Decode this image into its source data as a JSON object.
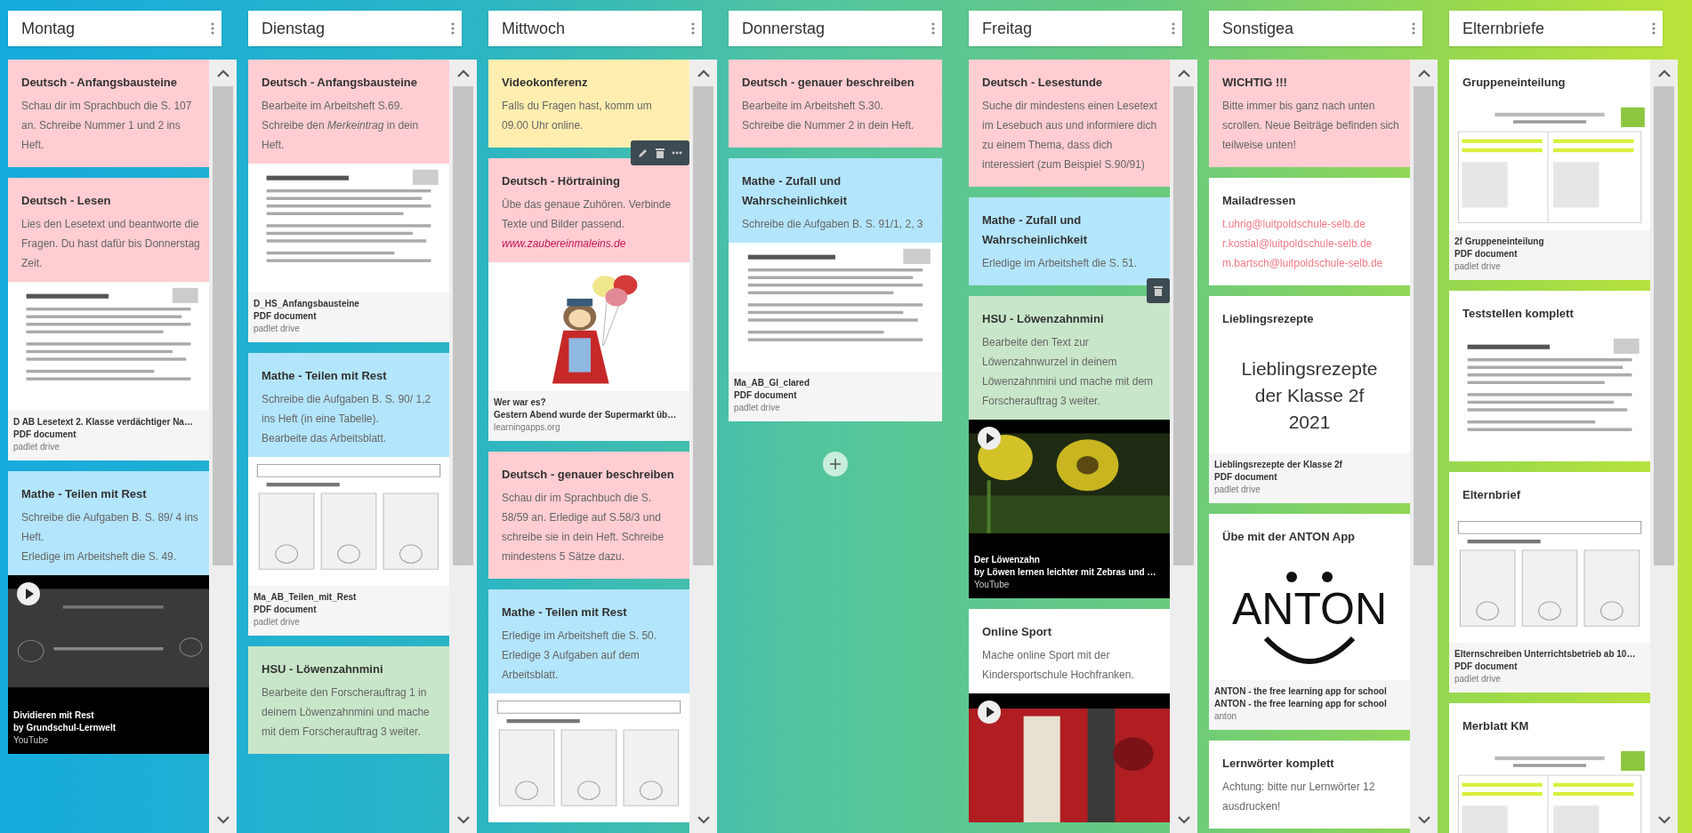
{
  "columns": [
    {
      "title": "Montag",
      "scrollbar": true,
      "add_button": false,
      "posts": [
        {
          "color": "#ffcdd2",
          "title": "Deutsch - Anfangsbausteine",
          "body": [
            "Schau dir im Sprachbuch die S. 107 an. Schreibe Nummer 1 und 2 ins Heft."
          ]
        },
        {
          "color": "#ffcdd2",
          "title": "Deutsch - Lesen",
          "body": [
            "Lies den Lesetext und beantworte die Fragen. Du hast dafür bis Donnerstag Zeit."
          ],
          "attachment": {
            "kind": "pdf",
            "title": "D AB Lesetext 2. Klasse verdächtiger Na…",
            "type": "PDF document",
            "source": "padlet drive"
          }
        },
        {
          "color": "#b3e5fc",
          "title": "Mathe - Teilen mit Rest",
          "body": [
            "Schreibe die Aufgaben B. S. 89/ 4 ins Heft.",
            "Erledige im Arbeitsheft die S. 49."
          ],
          "attachment": {
            "kind": "video",
            "title": "Dividieren mit Rest",
            "type": "by Grundschul-Lernwelt",
            "source": "YouTube"
          }
        }
      ]
    },
    {
      "title": "Dienstag",
      "scrollbar": true,
      "add_button": false,
      "posts": [
        {
          "color": "#ffcdd2",
          "title": "Deutsch - Anfangsbausteine",
          "body": [
            "Bearbeite im Arbeitsheft S.69.",
            "Schreibe den *Merkeintrag* in dein Heft."
          ],
          "attachment": {
            "kind": "pdf",
            "title": "D_HS_Anfangsbausteine",
            "type": "PDF document",
            "source": "padlet drive"
          }
        },
        {
          "color": "#b3e5fc",
          "title": "Mathe - Teilen mit Rest",
          "body": [
            "Schreibe die Aufgaben B. S. 90/ 1,2 ins Heft (in eine Tabelle).",
            "Bearbeite das Arbeitsblatt."
          ],
          "attachment": {
            "kind": "pdf",
            "title": "Ma_AB_Teilen_mit_Rest",
            "type": "PDF document",
            "source": "padlet drive"
          }
        },
        {
          "color": "#c8e6c9",
          "title": "HSU - Löwenzahnmini",
          "body": [
            "Bearbeite den Forscherauftrag 1 in deinem Löwenzahnmini und mache mit dem Forscherauftrag 3 weiter."
          ]
        }
      ]
    },
    {
      "title": "Mittwoch",
      "scrollbar": true,
      "add_button": false,
      "posts": [
        {
          "color": "#ffeeb0",
          "title": "Videokonferenz",
          "body": [
            "Falls du Fragen hast, komm um 09.00 Uhr online."
          ],
          "hover_actions": [
            {
              "kind": "edit"
            },
            {
              "kind": "delete"
            },
            {
              "kind": "more"
            }
          ]
        },
        {
          "color": "#ffcdd2",
          "title": "Deutsch - Hörtraining",
          "body": [
            "Übe das genaue Zuhören. Verbinde Texte und Bilder passend."
          ],
          "links": [
            {
              "kind": "web",
              "text": "www.zaubereinmaleins.de"
            }
          ],
          "attachment": {
            "kind": "link",
            "title": "Wer war es?",
            "type": "Gestern Abend wurde der Supermarkt üb…",
            "source": "learningapps.org"
          }
        },
        {
          "color": "#ffcdd2",
          "title": "Deutsch - genauer beschreiben",
          "body": [
            "Schau dir im Sprachbuch die S. 58/59 an. Erledige auf S.58/3 und schreibe sie in dein Heft. Schreibe mindestens 5 Sätze dazu."
          ]
        },
        {
          "color": "#b3e5fc",
          "title": "Mathe - Teilen mit Rest",
          "body": [
            "Erledige im Arbeitsheft die S. 50. Erledige 3 Aufgaben auf dem Arbeitsblatt."
          ],
          "attachment": {
            "kind": "pdf"
          }
        }
      ]
    },
    {
      "title": "Donnerstag",
      "scrollbar": false,
      "add_button": true,
      "posts": [
        {
          "color": "#ffcdd2",
          "title": "Deutsch - genauer beschreiben",
          "body": [
            "Bearbeite im Arbeitsheft S.30.",
            "Schreibe die Nummer 2 in dein Heft."
          ]
        },
        {
          "color": "#b3e5fc",
          "title": "Mathe - Zufall und Wahrscheinlichkeit",
          "body": [
            "Schreibe die Aufgaben B. S.  91/1, 2, 3"
          ],
          "attachment": {
            "kind": "pdf",
            "title": "Ma_AB_Gl_clared",
            "type": "PDF document",
            "source": "padlet drive"
          }
        }
      ]
    },
    {
      "title": "Freitag",
      "scrollbar": true,
      "add_button": false,
      "posts": [
        {
          "color": "#ffcdd2",
          "title": "Deutsch - Lesestunde",
          "body": [
            "Suche dir mindestens einen Lesetext im Lesebuch aus und informiere dich zu einem Thema, dass dich interessiert (zum Beispiel S.90/91)"
          ]
        },
        {
          "color": "#b3e5fc",
          "title": "Mathe - Zufall und Wahrscheinlichkeit",
          "body": [
            "Erledige im Arbeitsheft die S. 51."
          ],
          "hover_actions": [
            {
              "kind": "delete"
            }
          ]
        },
        {
          "color": "#c8e6c9",
          "title": "HSU - Löwenzahnmini",
          "body": [
            "Bearbeite den Text zur Löwenzahnwurzel in deinem Löwenzahnmini und mache mit dem Forscherauftrag 3 weiter."
          ],
          "attachment": {
            "kind": "video",
            "title": "Der Löwenzahn",
            "type": "by Löwen lernen leichter mit Zebras und …",
            "source": "YouTube"
          }
        },
        {
          "color": "#ffffff",
          "title": "Online Sport",
          "body": [
            "Mache online Sport mit der Kindersportschule Hochfranken."
          ],
          "attachment": {
            "kind": "video"
          }
        }
      ]
    },
    {
      "title": "Sonstigea",
      "scrollbar": true,
      "add_button": false,
      "posts": [
        {
          "color": "#ffcdd2",
          "title": "WICHTIG !!!",
          "body": [
            "Bitte immer bis ganz nach unten scrollen. Neue Beiträge befinden sich teilweise unten!"
          ]
        },
        {
          "color": "#ffffff",
          "title": "Mailadressen",
          "links": [
            {
              "kind": "mail",
              "text": "t.uhrig@luitpoldschule-selb.de"
            },
            {
              "kind": "mail",
              "text": "r.kostial@luitpoldschule-selb.de"
            },
            {
              "kind": "mail",
              "text": "m.bartsch@luitpoldschule-selb.de"
            }
          ]
        },
        {
          "color": "#ffffff",
          "title": "Lieblingsrezepte",
          "attachment": {
            "kind": "pdf",
            "preview": {
              "kind": "text",
              "lines": [
                "Lieblingsrezepte",
                "der Klasse 2f",
                "2021"
              ]
            },
            "title": "Lieblingsrezepte der Klasse 2f",
            "type": "PDF document",
            "source": "padlet drive"
          }
        },
        {
          "color": "#ffffff",
          "title": "Übe mit der ANTON App",
          "attachment": {
            "kind": "link",
            "preview": {
              "kind": "logo",
              "text": "ANTON"
            },
            "title": "ANTON - the free learning app for school",
            "type": "ANTON - the free learning app for school",
            "source": "anton"
          }
        },
        {
          "color": "#ffffff",
          "title": "Lernwörter komplett",
          "body": [
            "Achtung: bitte nur Lernwörter 12 ausdrucken!"
          ]
        }
      ]
    },
    {
      "title": "Elternbriefe",
      "scrollbar": true,
      "add_button": false,
      "posts": [
        {
          "color": "#ffffff",
          "title": "Gruppeneinteilung",
          "attachment": {
            "kind": "pdf",
            "title": "2f Gruppeneinteilung",
            "type": "PDF document",
            "source": "padlet drive"
          }
        },
        {
          "color": "#ffffff",
          "title": "Teststellen komplett",
          "attachment": {
            "kind": "pdf"
          }
        },
        {
          "color": "#ffffff",
          "title": "Elternbrief",
          "attachment": {
            "kind": "pdf",
            "title": "Elternschreiben Unterrichtsbetrieb ab 10…",
            "type": "PDF document",
            "source": "padlet drive"
          }
        },
        {
          "color": "#ffffff",
          "title": "Merblatt KM",
          "attachment": {
            "kind": "pdf"
          }
        }
      ]
    }
  ]
}
